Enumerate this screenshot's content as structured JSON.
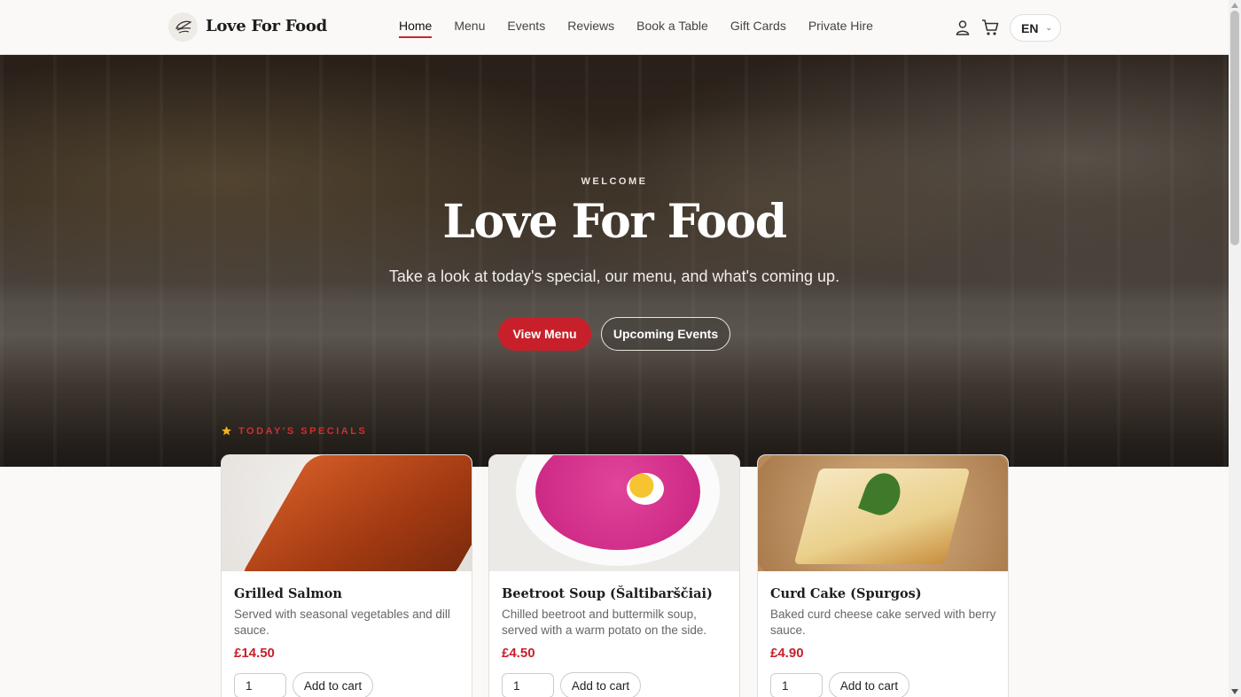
{
  "brand": {
    "name": "Love For Food"
  },
  "nav": [
    {
      "label": "Home",
      "active": true
    },
    {
      "label": "Menu",
      "active": false
    },
    {
      "label": "Events",
      "active": false
    },
    {
      "label": "Reviews",
      "active": false
    },
    {
      "label": "Book a Table",
      "active": false
    },
    {
      "label": "Gift Cards",
      "active": false
    },
    {
      "label": "Private Hire",
      "active": false
    }
  ],
  "header": {
    "language": "EN",
    "icons": [
      "user-icon",
      "cart-icon"
    ]
  },
  "hero": {
    "eyebrow": "WELCOME",
    "title": "Love For Food",
    "subtitle": "Take a look at today's special, our menu, and what's coming up.",
    "primary_button": "View Menu",
    "secondary_button": "Upcoming Events"
  },
  "specials": {
    "label": "TODAY'S SPECIALS",
    "items": [
      {
        "title": "Grilled Salmon",
        "description": "Served with seasonal vegetables and dill sauce.",
        "price": "£14.50",
        "quantity": "1",
        "button": "Add to cart"
      },
      {
        "title": "Beetroot Soup (Šaltibarščiai)",
        "description": "Chilled beetroot and buttermilk soup, served with a warm potato on the side.",
        "price": "£4.50",
        "quantity": "1",
        "button": "Add to cart"
      },
      {
        "title": "Curd Cake (Spurgos)",
        "description": "Baked curd cheese cake served with berry sauce.",
        "price": "£4.90",
        "quantity": "1",
        "button": "Add to cart"
      }
    ]
  },
  "colors": {
    "accent": "#c8202a",
    "background": "#faf9f7"
  }
}
